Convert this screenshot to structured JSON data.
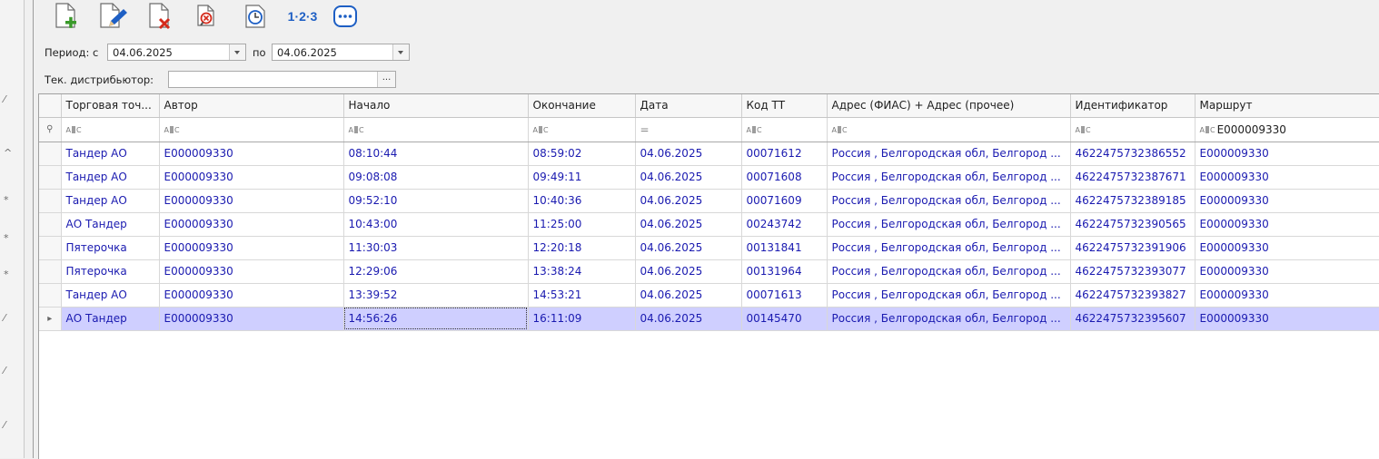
{
  "toolbar": {
    "buttons": [
      {
        "name": "add-document-button",
        "icon": "document-add-icon"
      },
      {
        "name": "edit-document-button",
        "icon": "document-edit-icon"
      },
      {
        "name": "delete-document-button",
        "icon": "document-delete-icon"
      },
      {
        "name": "view-document-button",
        "icon": "document-search-icon"
      },
      {
        "name": "history-button",
        "icon": "clock-document-icon"
      },
      {
        "name": "numbering-button",
        "icon": "numbers-icon",
        "label": "1·2·3"
      },
      {
        "name": "more-button",
        "icon": "more-dots-icon"
      }
    ]
  },
  "filters": {
    "period_from_label": "Период: с",
    "period_from_value": "04.06.2025",
    "period_to_label": "по",
    "period_to_value": "04.06.2025",
    "distributor_label": "Тек. дистрибьютор:",
    "distributor_value": ""
  },
  "grid": {
    "columns": [
      "Торговая точ...",
      "Автор",
      "Начало",
      "Окончание",
      "Дата",
      "Код ТТ",
      "Адрес (ФИАС) + Адрес (прочее)",
      "Идентификатор",
      "Маршрут"
    ],
    "filter_row": {
      "route_filter": "E000009330",
      "date_operator": "="
    },
    "rows": [
      [
        "Тандер АО",
        "E000009330",
        "08:10:44",
        "08:59:02",
        "04.06.2025",
        "00071612",
        "Россия , Белгородская обл, Белгород ...",
        "4622475732386552",
        "E000009330"
      ],
      [
        "Тандер АО",
        "E000009330",
        "09:08:08",
        "09:49:11",
        "04.06.2025",
        "00071608",
        "Россия , Белгородская обл, Белгород ...",
        "4622475732387671",
        "E000009330"
      ],
      [
        "Тандер АО",
        "E000009330",
        "09:52:10",
        "10:40:36",
        "04.06.2025",
        "00071609",
        "Россия , Белгородская обл, Белгород ...",
        "4622475732389185",
        "E000009330"
      ],
      [
        "АО Тандер",
        "E000009330",
        "10:43:00",
        "11:25:00",
        "04.06.2025",
        "00243742",
        "Россия , Белгородская обл, Белгород ...",
        "4622475732390565",
        "E000009330"
      ],
      [
        "Пятерочка",
        "E000009330",
        "11:30:03",
        "12:20:18",
        "04.06.2025",
        "00131841",
        "Россия , Белгородская обл, Белгород ...",
        "4622475732391906",
        "E000009330"
      ],
      [
        "Пятерочка",
        "E000009330",
        "12:29:06",
        "13:38:24",
        "04.06.2025",
        "00131964",
        "Россия , Белгородская обл, Белгород ...",
        "4622475732393077",
        "E000009330"
      ],
      [
        "Тандер АО",
        "E000009330",
        "13:39:52",
        "14:53:21",
        "04.06.2025",
        "00071613",
        "Россия , Белгородская обл, Белгород ...",
        "4622475732393827",
        "E000009330"
      ],
      [
        "АО Тандер",
        "E000009330",
        "14:56:26",
        "16:11:09",
        "04.06.2025",
        "00145470",
        "Россия , Белгородская обл, Белгород ...",
        "4622475732395607",
        "E000009330"
      ]
    ],
    "selected_row": 7
  },
  "colors": {
    "cell_text": "#1a1ab0",
    "selection": "#cfcfff",
    "icon_blue": "#1e5fc4",
    "icon_red": "#d42a1b",
    "icon_green": "#3a9a2a"
  }
}
